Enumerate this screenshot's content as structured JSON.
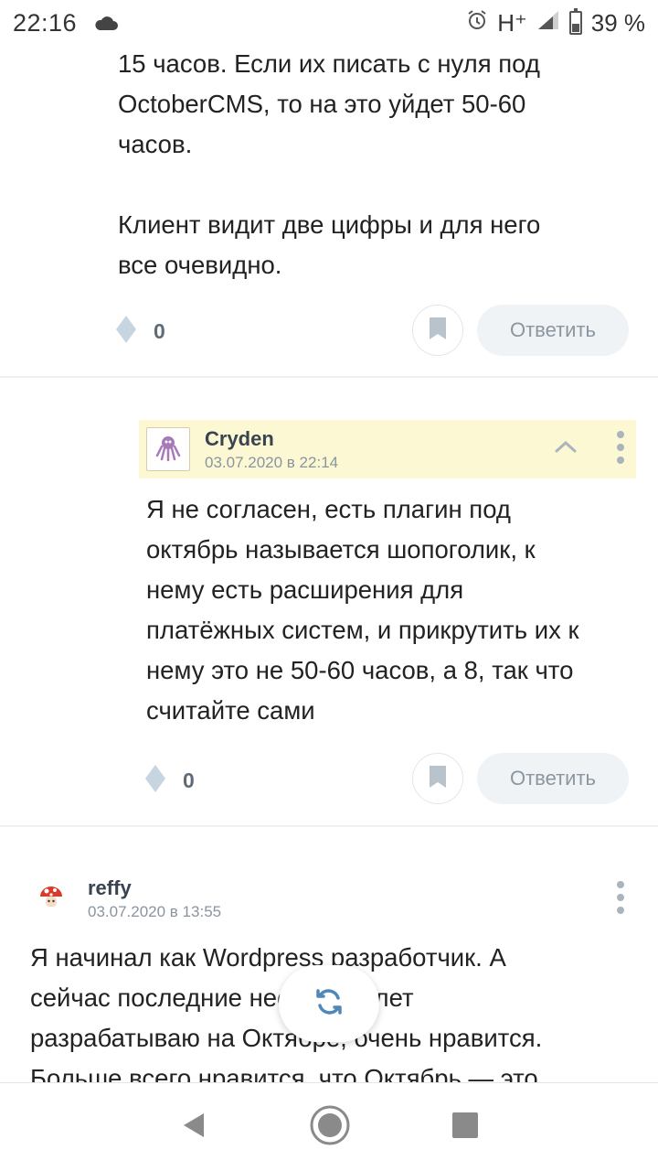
{
  "status_bar": {
    "time": "22:16",
    "network": "H⁺",
    "battery": "39 %"
  },
  "comments": [
    {
      "lines": [
        "15 часов. Если их писать с нуля под",
        "OctoberCMS, то на это уйдет 50-60",
        "часов.",
        "",
        "Клиент видит две цифры и для него",
        "все очевидно."
      ],
      "votes": "0",
      "reply_label": "Ответить"
    },
    {
      "author": "Cryden",
      "date": "03.07.2020 в 22:14",
      "lines": [
        "Я не согласен, есть плагин под",
        "октябрь называется шопоголик, к",
        "нему есть расширения для",
        "платёжных систем, и прикрутить их к",
        "нему это не 50-60 часов, а 8, так что",
        "считайте сами"
      ],
      "votes": "0",
      "reply_label": "Ответить"
    },
    {
      "author": "reffy",
      "date": "03.07.2020 в 13:55",
      "lines": [
        "Я начинал как Wordpress разработчик. А",
        "сейчас последние несколько лет",
        "разрабатываю на Октябре, очень нравится.",
        "Больше всего нравится, что Октябрь — это"
      ]
    }
  ],
  "colors": {
    "highlight_bg": "#fdf8d4",
    "muted": "#a9b4be",
    "reply_bg": "#f0f3f5"
  }
}
